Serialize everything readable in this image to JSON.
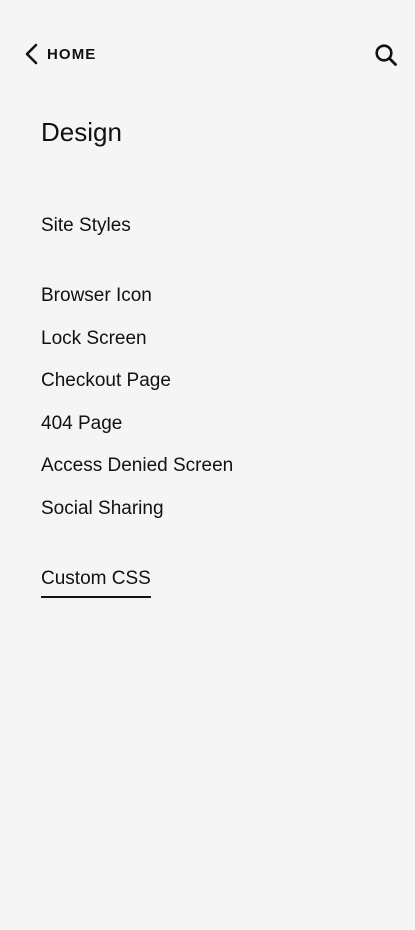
{
  "header": {
    "back_label": "HOME",
    "back_icon": "chevron-left-icon",
    "search_icon": "search-icon"
  },
  "page": {
    "title": "Design"
  },
  "menu": {
    "primary": [
      "Site Styles"
    ],
    "secondary": [
      "Browser Icon",
      "Lock Screen",
      "Checkout Page",
      "404 Page",
      "Access Denied Screen",
      "Social Sharing"
    ],
    "tertiary": [
      "Custom CSS"
    ],
    "active_item": "Custom CSS"
  },
  "colors": {
    "background": "#f5f5f5",
    "text": "#111111"
  }
}
